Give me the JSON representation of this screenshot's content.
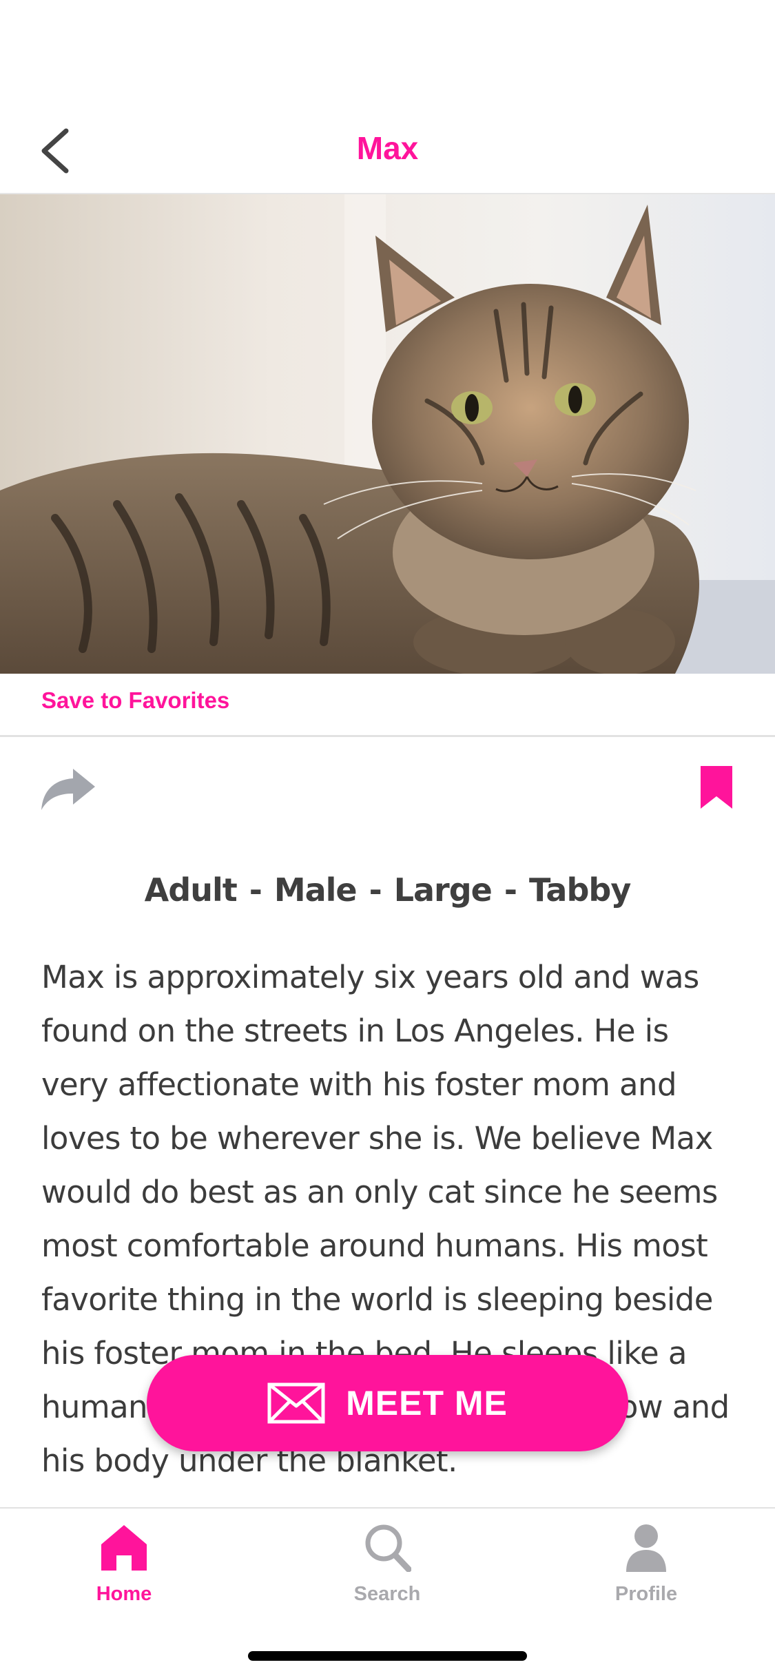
{
  "header": {
    "title": "Max"
  },
  "actions": {
    "save_favorites": "Save to Favorites"
  },
  "pet": {
    "attributes": [
      "Adult",
      "Male",
      "Large",
      "Tabby"
    ],
    "attribute_separator": "-",
    "description": "Max is approximately six years old and was found on the streets in Los Angeles. He is very affectionate with his foster mom and loves to be wherever she is. We believe Max would do best as an only cat since he seems most comfortable around humans. His most favorite thing in the world is sleeping beside his foster mom in the bed. He sleeps like a human with laying his head on the pillow and his body under the blanket."
  },
  "cta": {
    "label": "MEET ME",
    "icon": "envelope-icon"
  },
  "tabs": [
    {
      "label": "Home",
      "icon": "home-icon",
      "active": true
    },
    {
      "label": "Search",
      "icon": "search-icon",
      "active": false
    },
    {
      "label": "Profile",
      "icon": "profile-icon",
      "active": false
    }
  ],
  "colors": {
    "accent": "#ff149b",
    "inactive": "#a9a9ad",
    "text": "#3c3c3c"
  }
}
